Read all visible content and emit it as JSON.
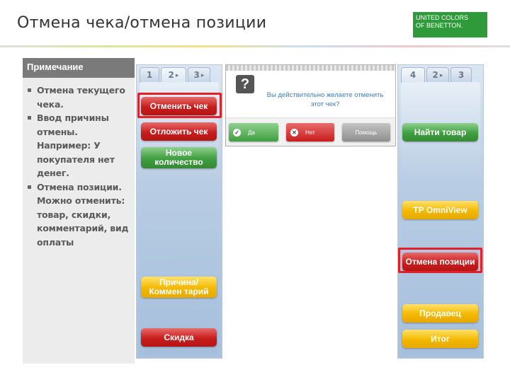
{
  "title": "Отмена чека/отмена позиции",
  "logo": {
    "line1": "UNITED COLORS",
    "line2": "OF BENETTON."
  },
  "notes": {
    "heading": "Примечание",
    "items": [
      "Отмена текущего чека.",
      "Ввод причины отмены. Например: У покупателя нет денег.",
      "Отмена позиции. Можно отменить: товар, скидки, комментарий, вид оплаты"
    ]
  },
  "left_panel": {
    "tabs": [
      "1",
      "2",
      "3"
    ],
    "buttons": {
      "cancel_check": "Отменить чек",
      "postpone_check": "Отложить чек",
      "new_quantity": "Новое количество",
      "reason_comment": "Причина/Коммен тарий",
      "discount": "Скидка"
    }
  },
  "dialog": {
    "question": "Вы действительно желаете отменить этот чек?",
    "yes": "Да",
    "no": "Нет",
    "help": "Помощь"
  },
  "right_panel": {
    "tabs": [
      "4",
      "2",
      "3"
    ],
    "buttons": {
      "find_item": "Найти товар",
      "tp_omniview": "TP OmniView",
      "cancel_position": "Отмена позиции",
      "seller": "Продавец",
      "total": "Итог"
    }
  },
  "colors": {
    "highlight": "#e2202a",
    "logo_green": "#2e9a3a",
    "button_red": "#c81d1d",
    "button_green": "#3f9e3f",
    "button_yellow": "#f3b800"
  }
}
